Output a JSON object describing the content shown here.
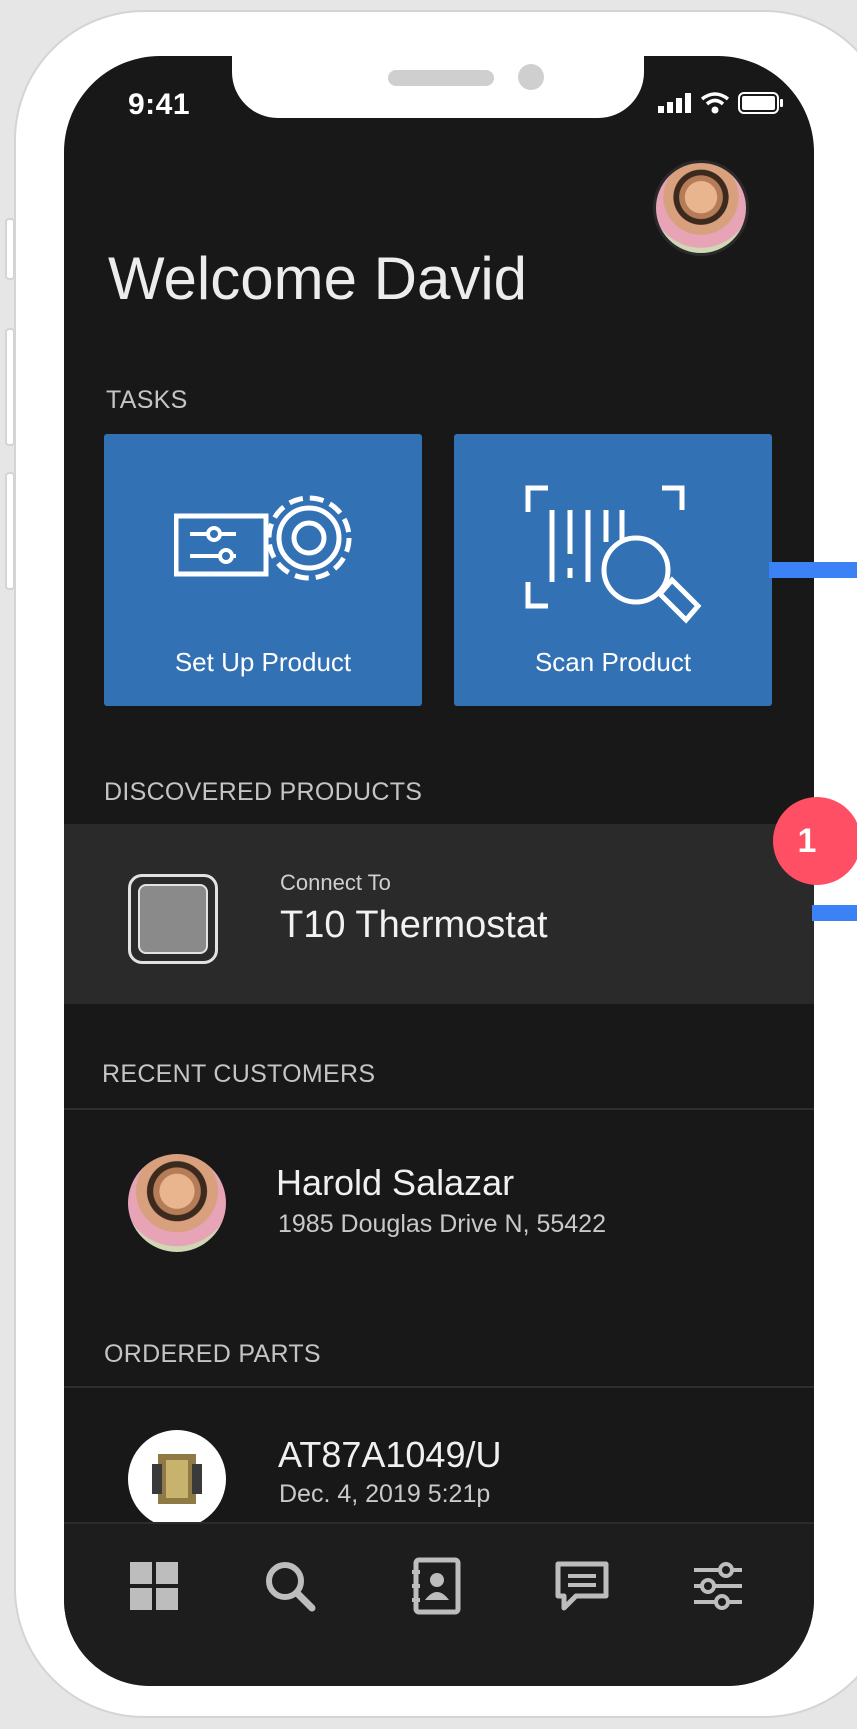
{
  "status_bar": {
    "time": "9:41"
  },
  "header": {
    "welcome": "Welcome David",
    "profile_avatar_icon": "user-avatar-photo"
  },
  "tasks": {
    "label": "TASKS",
    "items": [
      {
        "label": "Set Up Product",
        "icon": "setup-product-gear-icon"
      },
      {
        "label": "Scan Product",
        "icon": "scan-barcode-magnifier-icon"
      }
    ]
  },
  "discovered": {
    "label": "DISCOVERED PRODUCTS",
    "item": {
      "subtitle": "Connect To",
      "title": "T10 Thermostat",
      "icon": "thermostat-device-icon"
    }
  },
  "recent_customers": {
    "label": "RECENT CUSTOMERS",
    "items": [
      {
        "name": "Harold Salazar",
        "address": "1985 Douglas Drive N, 55422"
      }
    ]
  },
  "ordered_parts": {
    "label": "ORDERED PARTS",
    "items": [
      {
        "part": "AT87A1049/U",
        "date": "Dec. 4, 2019 5:21p"
      }
    ]
  },
  "tabbar": {
    "items": [
      {
        "name": "dashboard-grid-icon"
      },
      {
        "name": "search-icon"
      },
      {
        "name": "contacts-book-icon"
      },
      {
        "name": "messages-chat-icon"
      },
      {
        "name": "settings-sliders-icon"
      }
    ]
  },
  "annotation": {
    "badge": "1",
    "color": "#3b82f6",
    "badge_color": "#ff4f64"
  },
  "colors": {
    "accent": "#3371b5",
    "background": "#181818"
  }
}
